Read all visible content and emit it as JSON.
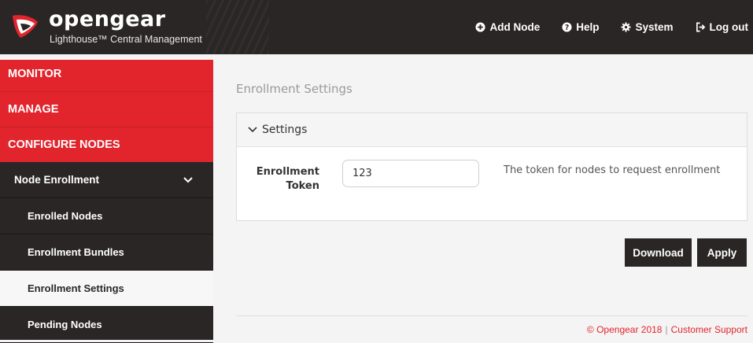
{
  "header": {
    "brand": "opengear",
    "tagline": "Lighthouse™ Central Management",
    "nav": [
      {
        "label": "Add Node",
        "icon": "plus-circle-icon"
      },
      {
        "label": "Help",
        "icon": "question-circle-icon"
      },
      {
        "label": "System",
        "icon": "gear-icon"
      },
      {
        "label": "Log out",
        "icon": "sign-out-icon"
      }
    ]
  },
  "sidebar": {
    "sections": [
      "MONITOR",
      "MANAGE",
      "CONFIGURE NODES"
    ],
    "group": {
      "label": "Node Enrollment",
      "expanded": true
    },
    "items": [
      "Enrolled Nodes",
      "Enrollment Bundles",
      "Enrollment Settings",
      "Pending Nodes"
    ],
    "active_item": "Enrollment Settings"
  },
  "main": {
    "title": "Enrollment Settings",
    "panel": {
      "heading": "Settings",
      "field": {
        "label_line1": "Enrollment",
        "label_line2": "Token",
        "value": "123",
        "help": "The token for nodes to request enrollment"
      }
    },
    "buttons": {
      "download": "Download",
      "apply": "Apply"
    }
  },
  "footer": {
    "copyright": "© Opengear 2018",
    "separator": "|",
    "support": "Customer Support"
  },
  "colors": {
    "accent": "#e2252d",
    "dark": "#2b2626",
    "background": "#f4f4f4"
  }
}
